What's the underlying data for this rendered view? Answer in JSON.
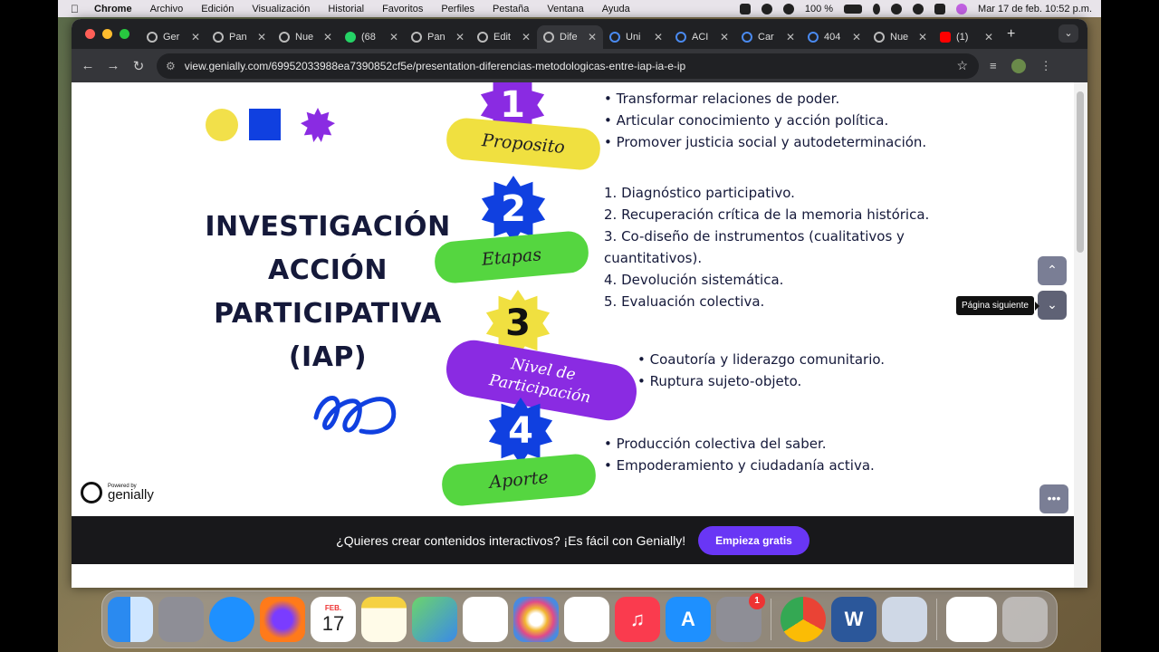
{
  "menubar": {
    "app": "Chrome",
    "items": [
      "Archivo",
      "Edición",
      "Visualización",
      "Historial",
      "Favoritos",
      "Perfiles",
      "Pestaña",
      "Ventana",
      "Ayuda"
    ],
    "battery": "100 %",
    "datetime": "Mar 17 de feb.  10:52 p.m."
  },
  "tabs": [
    {
      "label": "Ger",
      "active": false
    },
    {
      "label": "Pan",
      "active": false
    },
    {
      "label": "Nue",
      "active": false
    },
    {
      "label": "(68",
      "active": false,
      "fav_count": "68"
    },
    {
      "label": "Pan",
      "active": false
    },
    {
      "label": "Edit",
      "active": false
    },
    {
      "label": "Dife",
      "active": true
    },
    {
      "label": "Uni",
      "active": false
    },
    {
      "label": "ACI",
      "active": false
    },
    {
      "label": "Car",
      "active": false
    },
    {
      "label": "404",
      "active": false
    },
    {
      "label": "Nue",
      "active": false
    },
    {
      "label": "(1)",
      "active": false
    }
  ],
  "url": "view.genially.com/69952033988ea7390852cf5e/presentation-diferencias-metodologicas-entre-iap-ia-e-ip",
  "slide": {
    "title_lines": [
      "INVESTIGACIÓN",
      "ACCIÓN",
      "PARTICIPATIVA",
      "(IAP)"
    ],
    "steps": [
      {
        "number": "1",
        "label": "Proposito",
        "badge_color": "#8a2be2",
        "pill_color": "#f0e040",
        "items": [
          "• Transformar relaciones de poder.",
          "• Articular conocimiento y acción política.",
          "• Promover justicia social y autodeterminación."
        ]
      },
      {
        "number": "2",
        "label": "Etapas",
        "badge_color": "#1040e0",
        "pill_color": "#55d640",
        "items": [
          "1. Diagnóstico participativo.",
          "2. Recuperación crítica de la memoria histórica.",
          "3. Co-diseño de instrumentos (cualitativos y",
          "cuantitativos).",
          "4. Devolución sistemática.",
          "5. Evaluación colectiva."
        ]
      },
      {
        "number": "3",
        "label_lines": [
          "Nivel de",
          "Participación"
        ],
        "badge_color": "#f0e040",
        "pill_color": "#8a2be2",
        "items": [
          "• Coautoría y liderazgo comunitario.",
          "• Ruptura sujeto-objeto."
        ]
      },
      {
        "number": "4",
        "label": "Aporte",
        "badge_color": "#1040e0",
        "pill_color": "#55d640",
        "items": [
          "• Producción colectiva del saber.",
          "• Empoderamiento y ciudadanía activa."
        ]
      }
    ]
  },
  "tooltip": "Página siguiente",
  "powered": {
    "small": "Powered by",
    "brand": "genially"
  },
  "banner": {
    "text": "¿Quieres crear contenidos interactivos? ¡Es fácil con Genially!",
    "cta": "Empieza gratis"
  },
  "dock": {
    "calendar_month": "FEB.",
    "calendar_day": "17",
    "settings_badge": "1"
  }
}
